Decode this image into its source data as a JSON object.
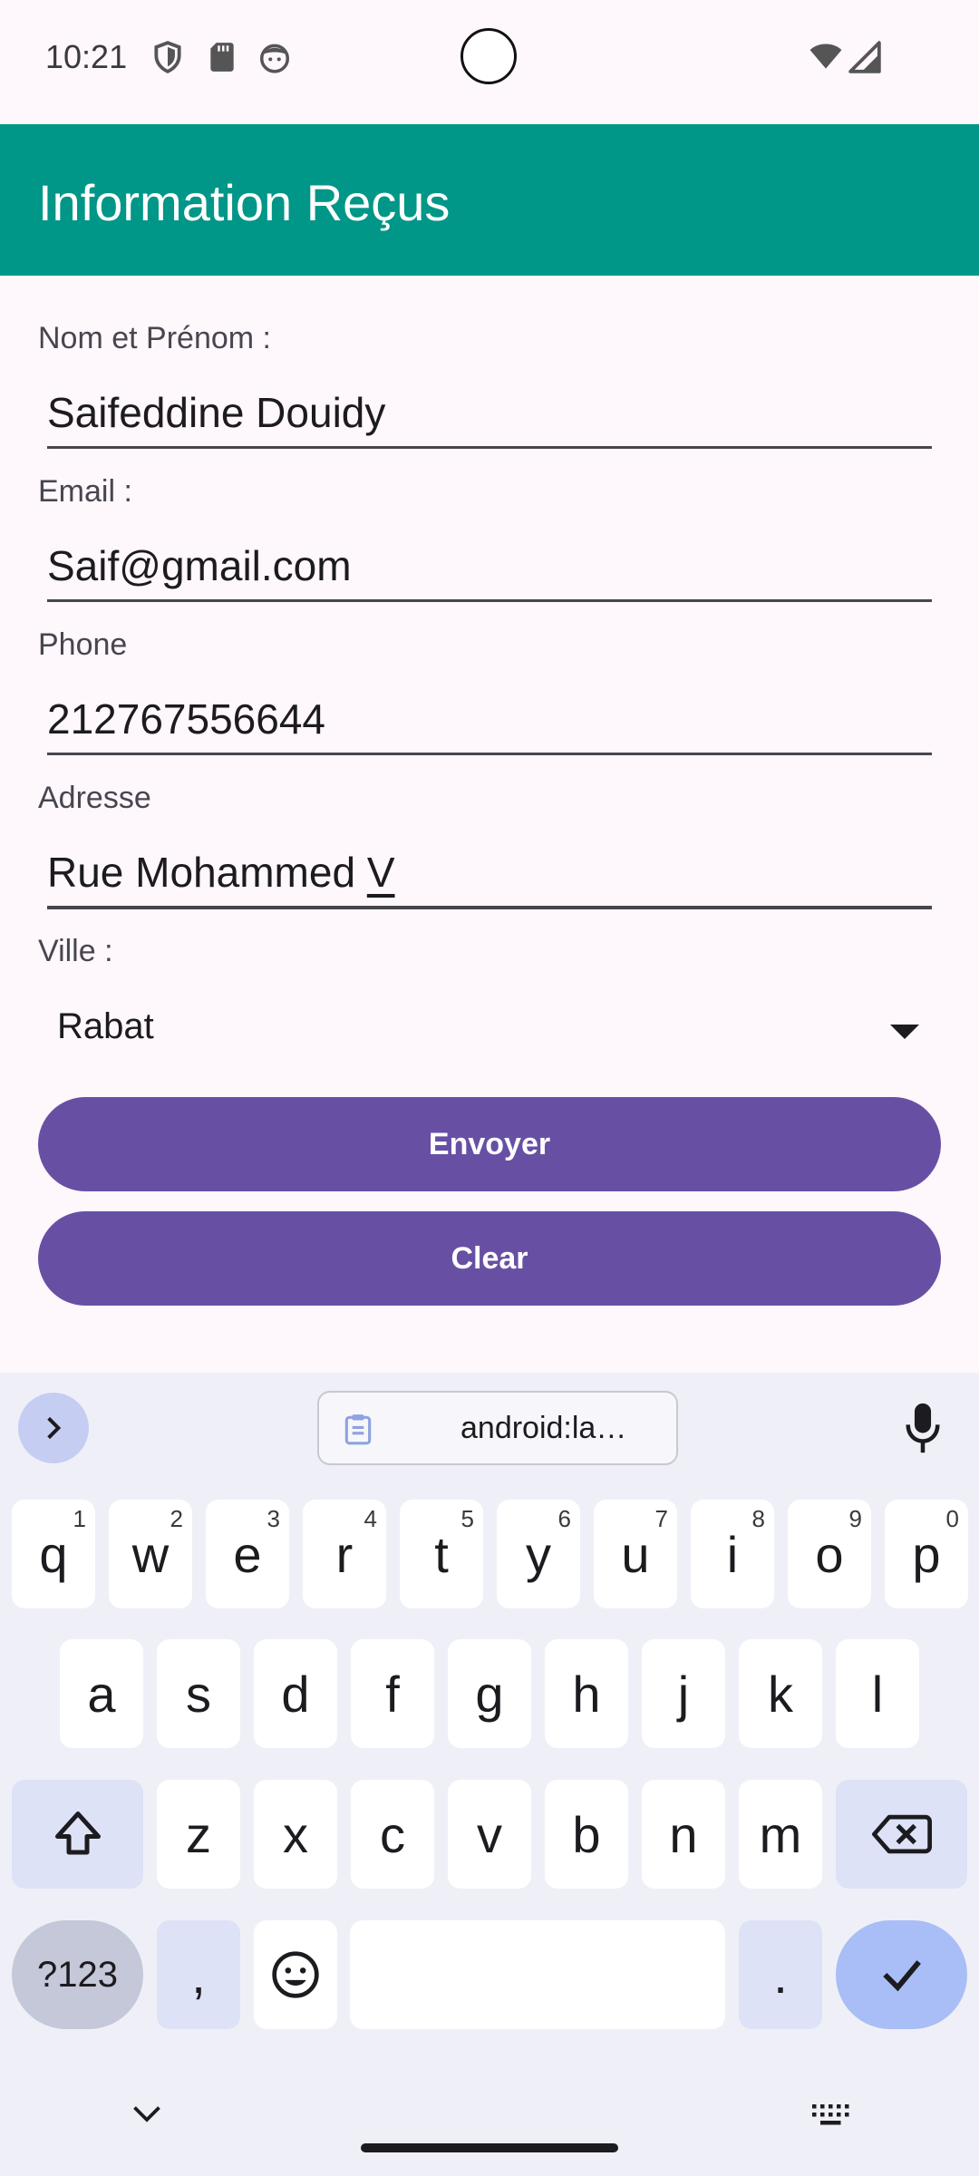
{
  "status_bar": {
    "time": "10:21",
    "icons": [
      "shield-icon",
      "sd-card-icon",
      "face-icon",
      "wifi-icon",
      "signal-icon"
    ]
  },
  "app_bar": {
    "title": "Information Reçus",
    "color": "#009688"
  },
  "form": {
    "name_label": "Nom et Prénom :",
    "name_value": "Saifeddine Douidy",
    "email_label": "Email :",
    "email_value": "Saif@gmail.com",
    "phone_label": "Phone",
    "phone_value": "212767556644",
    "address_label": "Adresse",
    "address_value_main": "Rue Mohammed ",
    "address_value_composing": "V",
    "city_label": "Ville :",
    "city_value": "Rabat",
    "send_button": "Envoyer",
    "clear_button": "Clear",
    "button_color": "#6750a4"
  },
  "keyboard": {
    "clipboard_suggestion": "android:la…",
    "row1": [
      {
        "k": "q",
        "h": "1"
      },
      {
        "k": "w",
        "h": "2"
      },
      {
        "k": "e",
        "h": "3"
      },
      {
        "k": "r",
        "h": "4"
      },
      {
        "k": "t",
        "h": "5"
      },
      {
        "k": "y",
        "h": "6"
      },
      {
        "k": "u",
        "h": "7"
      },
      {
        "k": "i",
        "h": "8"
      },
      {
        "k": "o",
        "h": "9"
      },
      {
        "k": "p",
        "h": "0"
      }
    ],
    "row2": [
      "a",
      "s",
      "d",
      "f",
      "g",
      "h",
      "j",
      "k",
      "l"
    ],
    "row3": [
      "z",
      "x",
      "c",
      "v",
      "b",
      "n",
      "m"
    ],
    "symbols_key": "?123",
    "comma_key": ",",
    "period_key": "."
  }
}
